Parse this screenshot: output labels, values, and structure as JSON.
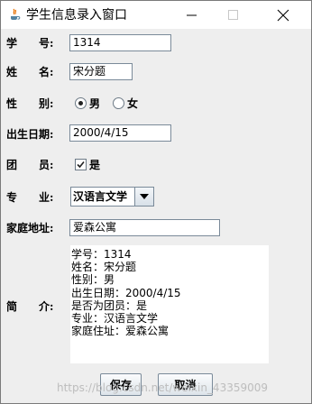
{
  "window": {
    "title": "学生信息录入窗口",
    "icons": [
      "java-app-icon",
      "minimize-icon",
      "maximize-icon",
      "close-icon"
    ]
  },
  "form": {
    "student_id": {
      "label": "学　　号:",
      "value": "1314"
    },
    "name": {
      "label": "姓　　名:",
      "value": "宋分题"
    },
    "gender": {
      "label": "性　　别:",
      "options": [
        "男",
        "女"
      ],
      "selected": "男"
    },
    "birth_date": {
      "label": "出生日期:",
      "value": "2000/4/15"
    },
    "member": {
      "label": "团　　员:",
      "checkbox_label": "是",
      "checked": true
    },
    "major": {
      "label": "专　　业:",
      "value": "汉语言文学"
    },
    "address": {
      "label": "家庭地址:",
      "value": "爱森公寓"
    },
    "intro": {
      "label": "简　　介:",
      "lines": [
        "学号：1314",
        "姓名：宋分题",
        "性别：男",
        "出生日期：2000/4/15",
        "是否为团员：是",
        "专业：汉语言文学",
        "家庭住址：爱森公寓"
      ]
    }
  },
  "buttons": {
    "save": "保存",
    "cancel": "取消"
  },
  "watermark": "https://blog.csdn.net/weixin_43359009",
  "colors": {
    "title_bg": "#ffffff",
    "window_bg": "#eeeeee",
    "field_border": "#7a8a99"
  }
}
